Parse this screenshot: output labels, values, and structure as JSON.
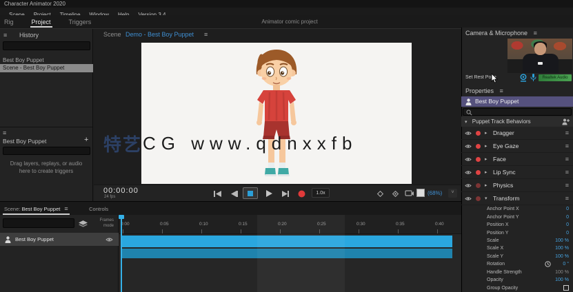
{
  "app": {
    "title": "Character Animator 2020"
  },
  "menu": {
    "items": [
      "Scene",
      "Project",
      "Timeline",
      "Window",
      "Help",
      "Version 3.4"
    ]
  },
  "workspace": {
    "tabs": [
      {
        "label": "Rig",
        "active": false
      },
      {
        "label": "Project",
        "active": true
      },
      {
        "label": "Triggers",
        "active": false
      }
    ],
    "document_title": "Animator comic project"
  },
  "project_panel": {
    "menu_icon": "≡",
    "title": "History",
    "search_value": "",
    "group_label": "Best Boy Puppet",
    "selected_item": "Scene - Best Boy Puppet"
  },
  "triggers_panel": {
    "menu_icon": "≡",
    "title": "Best Boy Puppet",
    "add_button": "+",
    "search_value": "",
    "empty_hint": "Drag layers, replays, or audio here to create triggers"
  },
  "scene": {
    "panel_label": "Scene",
    "scene_name": "Demo - Best Boy Puppet",
    "menu_icon": "≡",
    "watermark_left": "特艺",
    "watermark_text": "CG  www.qdnxxfb"
  },
  "transport": {
    "timecode": "00:00:00",
    "fps": "24 fps",
    "speed": "1.0x",
    "zoom": "(68%)",
    "zoom_chevron": "˅"
  },
  "camera_panel": {
    "title": "Camera & Microphone",
    "menu_icon": "≡",
    "set_rest_pose": "Set Rest Pose",
    "audio_meter": "Realtek Audio"
  },
  "properties_panel": {
    "title": "Properties",
    "menu_icon": "≡",
    "selected_puppet": "Best Boy Puppet",
    "section_title": "Puppet Track Behaviors",
    "behaviors": [
      {
        "name": "Dragger",
        "armed": true,
        "expanded": false
      },
      {
        "name": "Eye Gaze",
        "armed": true,
        "expanded": false
      },
      {
        "name": "Face",
        "armed": true,
        "expanded": false
      },
      {
        "name": "Lip Sync",
        "armed": true,
        "expanded": false
      },
      {
        "name": "Physics",
        "armed": false,
        "expanded": false
      },
      {
        "name": "Transform",
        "armed": false,
        "expanded": true
      }
    ],
    "transform_props": [
      {
        "name": "Anchor Point X",
        "value": "0",
        "unit": ""
      },
      {
        "name": "Anchor Point Y",
        "value": "0",
        "unit": ""
      },
      {
        "name": "Position X",
        "value": "0",
        "unit": ""
      },
      {
        "name": "Position Y",
        "value": "0",
        "unit": ""
      },
      {
        "name": "Scale",
        "value": "100",
        "unit": "%"
      },
      {
        "name": "Scale X",
        "value": "100",
        "unit": "%"
      },
      {
        "name": "Scale Y",
        "value": "100",
        "unit": "%"
      },
      {
        "name": "Rotation",
        "value": "0",
        "unit": "°",
        "clock": true
      },
      {
        "name": "Handle Strength",
        "value": "100",
        "unit": "%",
        "dim": true
      },
      {
        "name": "Opacity",
        "value": "100",
        "unit": "%"
      },
      {
        "name": "Group Opacity",
        "checkbox": true
      }
    ]
  },
  "timeline": {
    "tab_scene_prefix": "Scene:",
    "tab_scene_name": "Best Boy Puppet",
    "tab_scene_menu": "≡",
    "tab_controls": "Controls",
    "search_value": "",
    "mode_label_line1": "Frames",
    "mode_label_line2": "mode",
    "ruler_labels": [
      "0:00",
      "0:05",
      "0:10",
      "0:15",
      "0:20",
      "0:25",
      "0:30",
      "0:35",
      "0:40"
    ],
    "track_name": "Best Boy Puppet"
  },
  "colors": {
    "accent_blue": "#2b9fd8",
    "link_blue": "#3f8fd2",
    "record_red": "#e04343",
    "selected_purple": "#55517d",
    "value_blue": "#46a3e0",
    "meter_green": "#3d8a46",
    "track_blue": "#2aa7df"
  }
}
